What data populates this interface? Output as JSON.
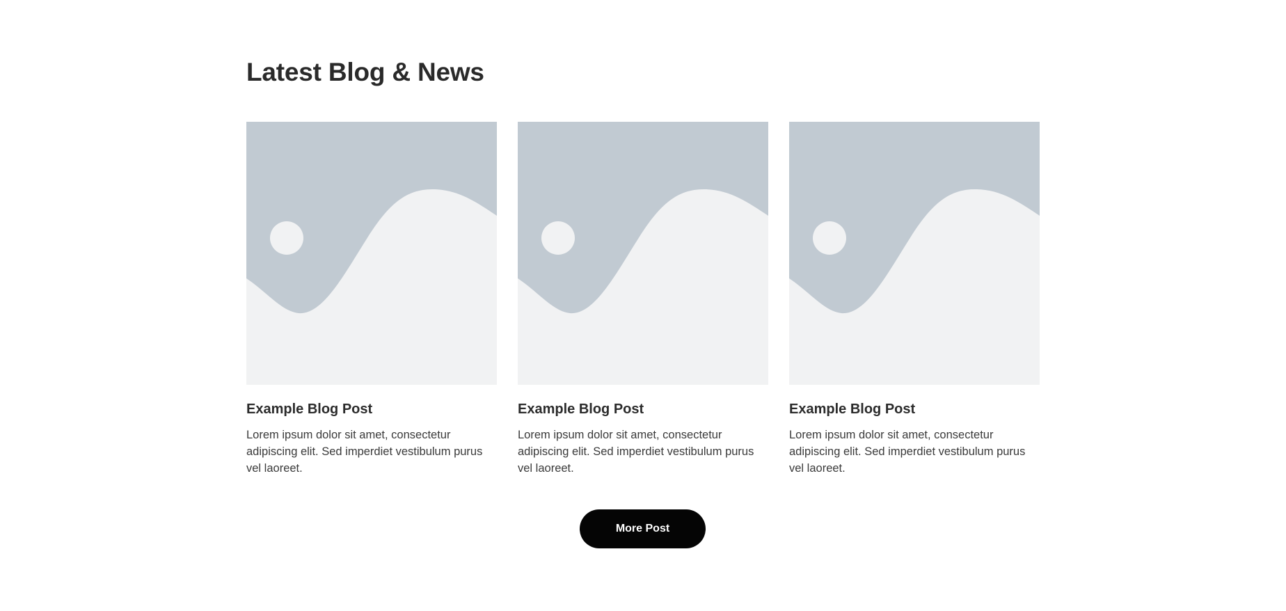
{
  "section": {
    "title": "Latest Blog & News"
  },
  "posts": [
    {
      "title": "Example Blog Post",
      "excerpt": "Lorem ipsum dolor sit amet, consectetur adipiscing elit. Sed imperdiet vestibulum purus vel laoreet.",
      "image_icon": "image-placeholder-icon"
    },
    {
      "title": "Example Blog Post",
      "excerpt": "Lorem ipsum dolor sit amet, consectetur adipiscing elit. Sed imperdiet vestibulum purus vel laoreet.",
      "image_icon": "image-placeholder-icon"
    },
    {
      "title": "Example Blog Post",
      "excerpt": "Lorem ipsum dolor sit amet, consectetur adipiscing elit. Sed imperdiet vestibulum purus vel laoreet.",
      "image_icon": "image-placeholder-icon"
    }
  ],
  "more_button": {
    "label": "More Post"
  },
  "colors": {
    "placeholder_sky": "#c1cad2",
    "placeholder_ground": "#f1f2f3",
    "button_bg": "#050505",
    "button_text": "#ffffff",
    "text": "#2b2b2b"
  }
}
